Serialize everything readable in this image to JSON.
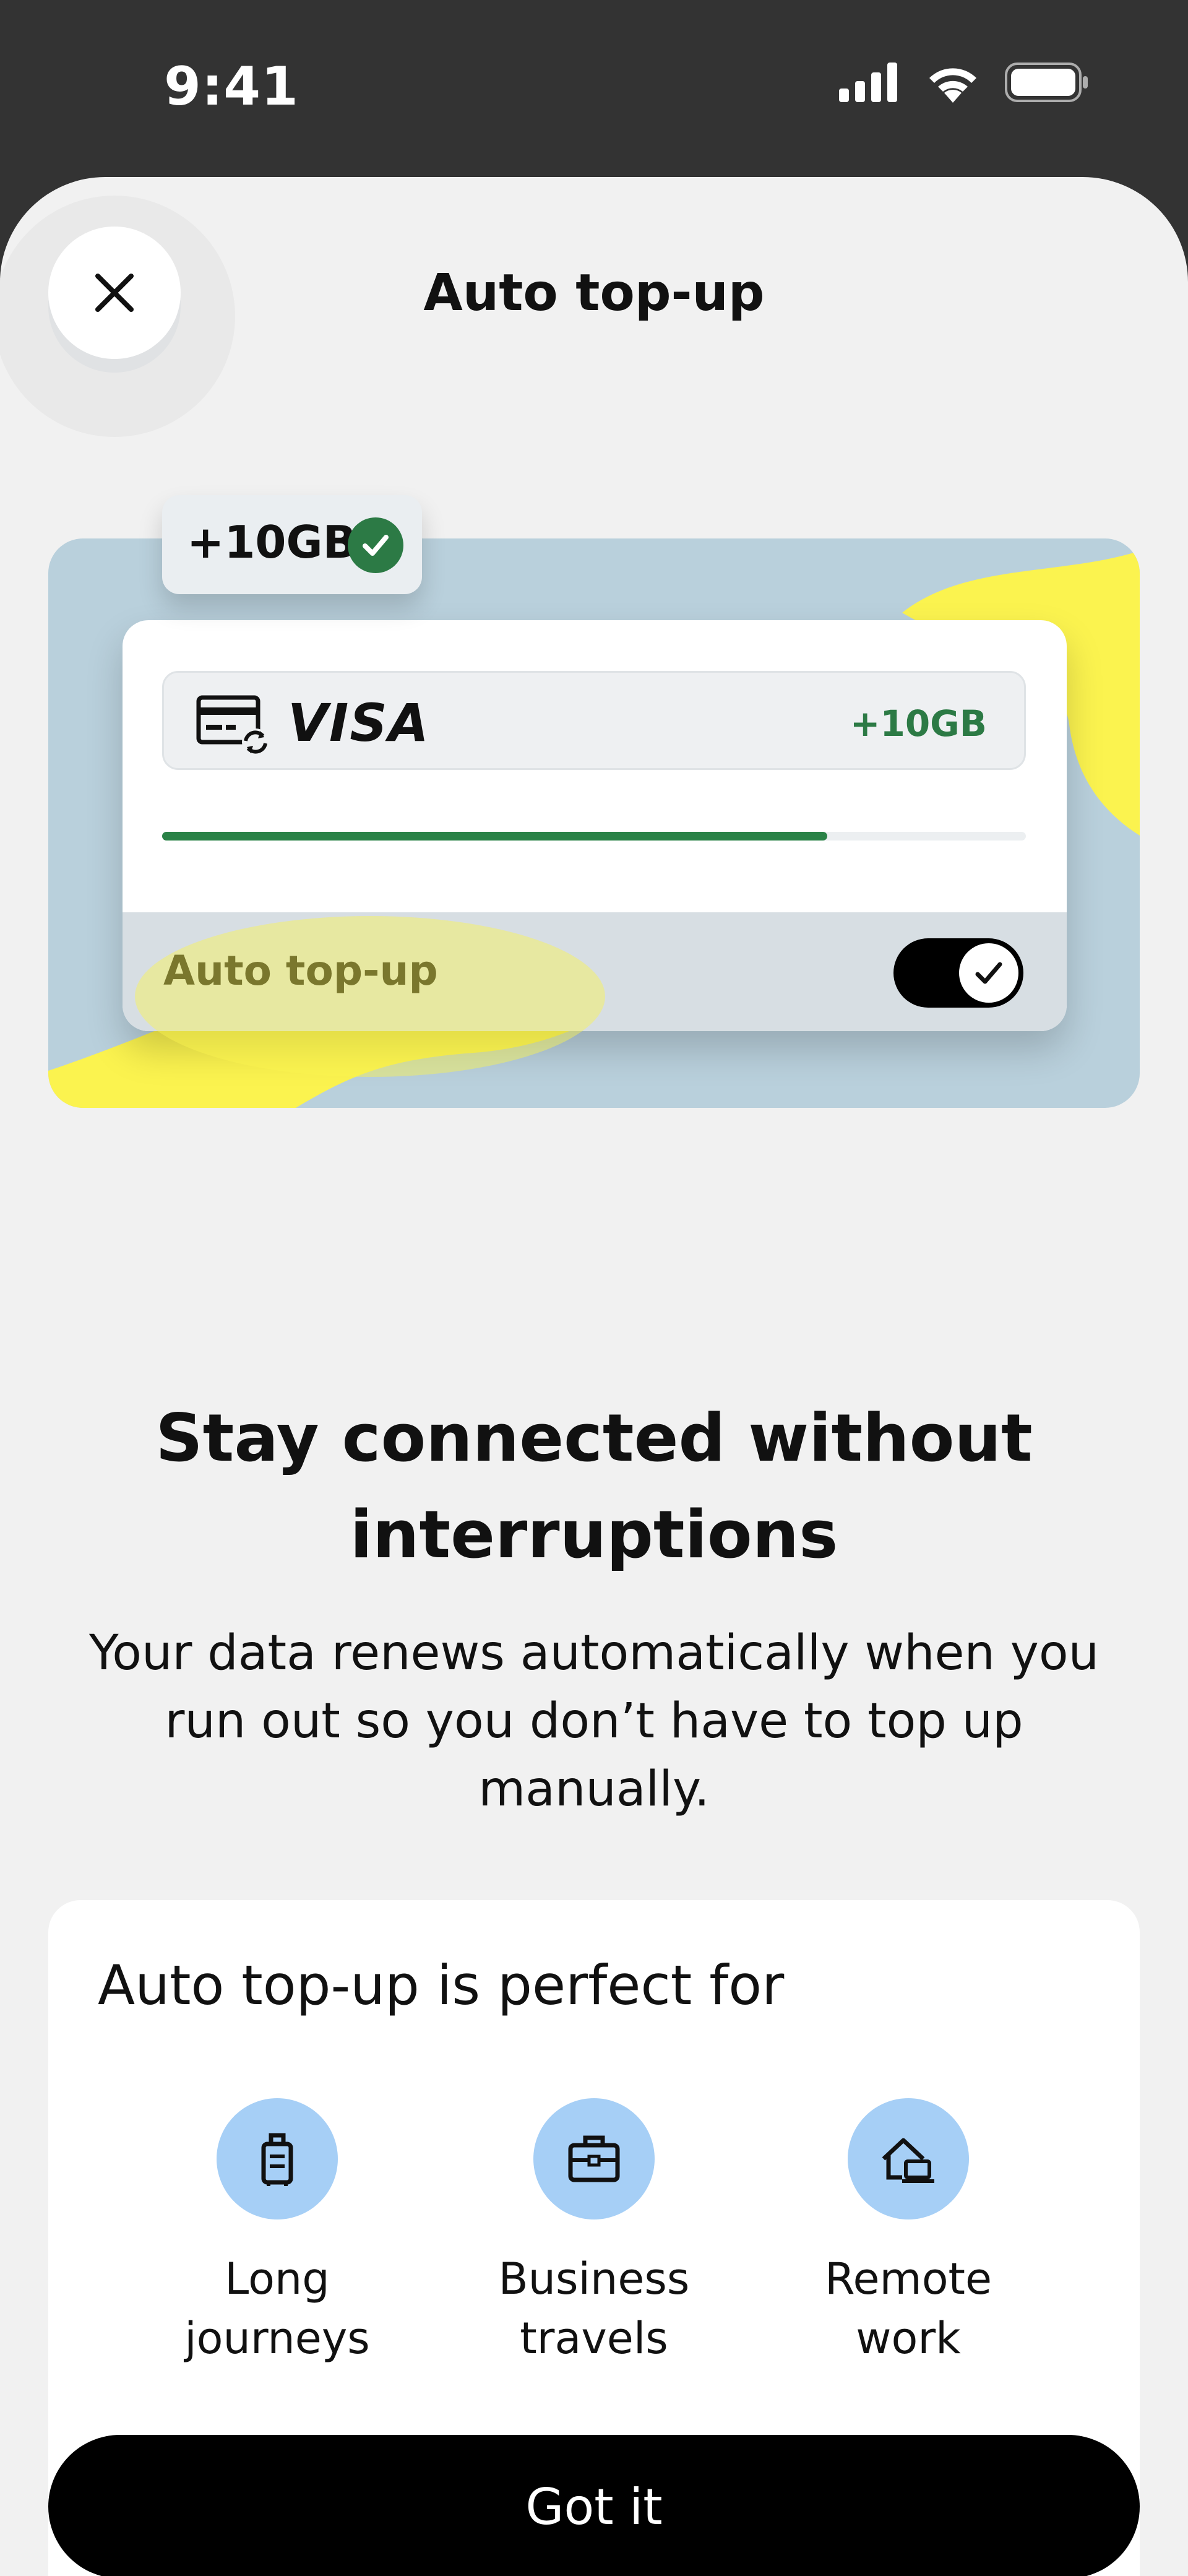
{
  "status_bar": {
    "time": "9:41",
    "icons": [
      "signal-icon",
      "wifi-icon",
      "battery-icon"
    ]
  },
  "header": {
    "title": "Auto top-up",
    "close_icon": "close-icon"
  },
  "hero": {
    "badge_text": "+10GB",
    "payment_card_brand": "VISA",
    "payment_amount": "+10GB",
    "progress_fraction": 0.77,
    "toggle_label": "Auto top-up",
    "toggle_on": true
  },
  "content": {
    "headline": "Stay connected without interruptions",
    "subtext": "Your data renews automatically when you run out so you don’t have to top up manually."
  },
  "perfect_for": {
    "title": "Auto top-up is perfect for",
    "items": [
      {
        "label": "Long journeys",
        "icon": "luggage-icon"
      },
      {
        "label": "Business travels",
        "icon": "briefcase-icon"
      },
      {
        "label": "Remote work",
        "icon": "home-laptop-icon"
      }
    ]
  },
  "cta": {
    "label": "Got it"
  },
  "colors": {
    "accent_green": "#2c7a45",
    "hero_blue": "#b9d0dc",
    "hero_yellow": "#fbf34f",
    "icon_circle": "#a6cff6"
  }
}
